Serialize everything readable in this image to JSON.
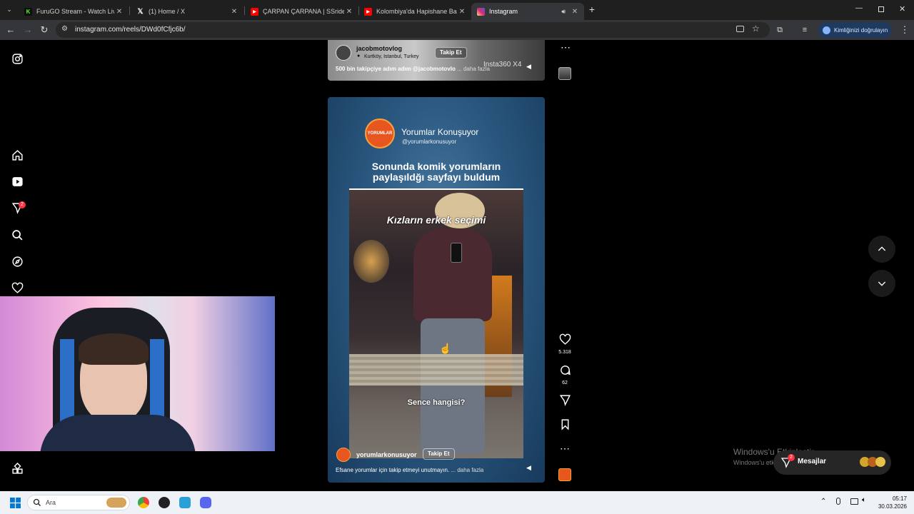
{
  "browser": {
    "tabs": [
      {
        "label": "FuruGO Stream - Watch Live o",
        "icon": "kick-icon",
        "color": "#53fc18",
        "active": false
      },
      {
        "label": "(1) Home / X",
        "icon": "x-icon",
        "color": "#000000",
        "active": false
      },
      {
        "label": "ÇARPAN ÇARPANA | SSriders | ",
        "icon": "youtube-icon",
        "color": "#ff0000",
        "active": false
      },
      {
        "label": "Kolombiya'da Hapishane Baskı",
        "icon": "youtube-icon",
        "color": "#ff0000",
        "active": false
      },
      {
        "label": "Instagram",
        "icon": "instagram-icon",
        "color": "#d6249f",
        "active": true
      }
    ],
    "url": "instagram.com/reels/DWd0fCfjc6b/",
    "verify_label": "Kimliğinizi doğrulayın"
  },
  "sidebar": {
    "notifications_badge": "2"
  },
  "reel_top": {
    "username": "jacobmotovlog",
    "location": "Kurtköy, Istanbul, Turkey",
    "follow_label": "Takip Et",
    "caption": "500 bin takipçiye adım adım @jacobmotovlo",
    "more_label": "... daha fazla",
    "watermark": "Insta360 X4"
  },
  "reel_main": {
    "header_name": "Yorumlar Konuşuyor",
    "header_handle": "@yorumlarkonusuyor",
    "logo_text": "YORUMLAR",
    "headline_line1": "Sonunda komik yorumların",
    "headline_line2": "paylaşıldğı sayfayı buldum",
    "overlay_title": "Kızların erkek seçimi",
    "overlay_question": "Sence hangisi?",
    "username": "yorumlarkonusuyor",
    "follow_label": "Takip Et",
    "caption": "Efsane yorumlar için takip etmeyi unutmayın.",
    "more_label": "... daha fazla"
  },
  "actions": {
    "likes": "5.318",
    "comments": "62"
  },
  "windows_activation": {
    "title": "Windows'u Etkinleştir",
    "subtitle": "Windows'u etkinleştirmek için Ayarlar'a gidin."
  },
  "messages": {
    "label": "Mesajlar",
    "badge": "2"
  },
  "taskbar": {
    "search_placeholder": "Ara",
    "time": "05:17",
    "date": "30.03.2026"
  }
}
